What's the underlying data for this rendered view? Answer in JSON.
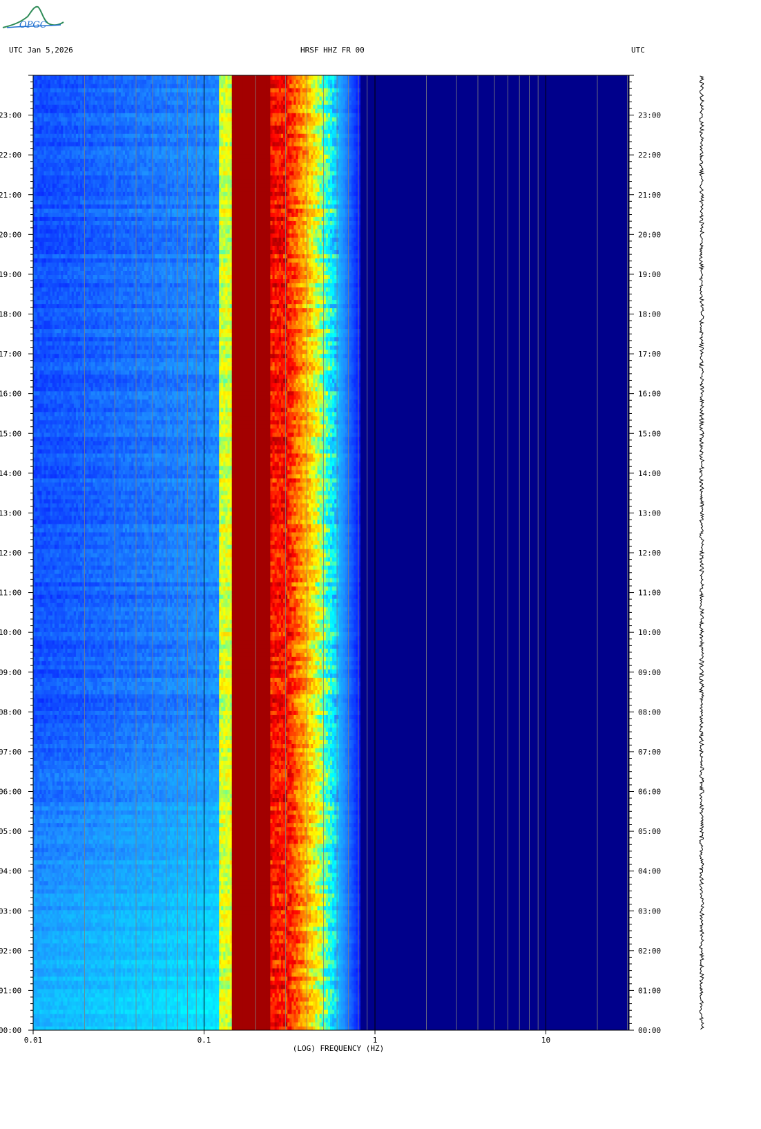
{
  "header": {
    "left_label": "UTC  Jan 5,2026",
    "center_label": "HRSF HHZ FR 00",
    "right_label": "UTC",
    "logo_text": "OPGC"
  },
  "chart_data": {
    "type": "heatmap",
    "title": "HRSF HHZ FR 00",
    "xlabel": "(LOG) FREQUENCY (HZ)",
    "ylabel": "UTC",
    "x_scale": "log",
    "xlim": [
      0.01,
      30
    ],
    "x_ticks": [
      {
        "value": 0.01,
        "label": "0.01"
      },
      {
        "value": 0.1,
        "label": "0.1"
      },
      {
        "value": 1,
        "label": "1"
      },
      {
        "value": 10,
        "label": "10"
      }
    ],
    "ylim_hours": [
      0,
      24
    ],
    "y_ticks": [
      "00:00",
      "01:00",
      "02:00",
      "03:00",
      "04:00",
      "05:00",
      "06:00",
      "07:00",
      "08:00",
      "09:00",
      "10:00",
      "11:00",
      "12:00",
      "13:00",
      "14:00",
      "15:00",
      "16:00",
      "17:00",
      "18:00",
      "19:00",
      "20:00",
      "21:00",
      "22:00",
      "23:00"
    ],
    "colormap": [
      "#00008b",
      "#0000ff",
      "#1e90ff",
      "#00ffff",
      "#ffff00",
      "#ff8c00",
      "#ff0000",
      "#8b0000"
    ],
    "description_bands": [
      {
        "f_min": 0.01,
        "f_max": 0.12,
        "level": "low"
      },
      {
        "f_min": 0.12,
        "f_max": 0.14,
        "level": "medium-high"
      },
      {
        "f_min": 0.14,
        "f_max": 0.3,
        "level": "peak"
      },
      {
        "f_min": 0.3,
        "f_max": 0.6,
        "level": "falloff"
      },
      {
        "f_min": 0.6,
        "f_max": 30,
        "level": "background"
      }
    ]
  }
}
